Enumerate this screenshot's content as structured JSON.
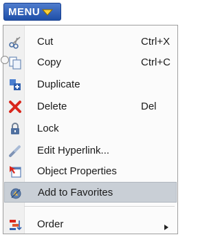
{
  "menu_button": {
    "label": "MENU",
    "icon": "caret-down-icon"
  },
  "items": [
    {
      "label": "Cut",
      "shortcut": "Ctrl+X",
      "icon": "scissors-icon"
    },
    {
      "label": "Copy",
      "shortcut": "Ctrl+C",
      "icon": "copy-icon"
    },
    {
      "label": "Duplicate",
      "shortcut": "",
      "icon": "duplicate-icon"
    },
    {
      "label": "Delete",
      "shortcut": "Del",
      "icon": "delete-x-icon"
    },
    {
      "label": "Lock",
      "shortcut": "",
      "icon": "lock-icon"
    },
    {
      "label": "Edit Hyperlink...",
      "shortcut": "",
      "icon": "link-icon"
    },
    {
      "label": "Object Properties",
      "shortcut": "",
      "icon": "properties-icon"
    },
    {
      "label": "Add to Favorites",
      "shortcut": "",
      "icon": "favorites-icon",
      "highlighted": true
    },
    {
      "label": "Order",
      "shortcut": "",
      "icon": "order-icon",
      "submenu": true
    }
  ],
  "colors": {
    "button_blue": "#2a5bb5",
    "highlight": "#c9cfd6",
    "delete_red": "#d9261c"
  }
}
